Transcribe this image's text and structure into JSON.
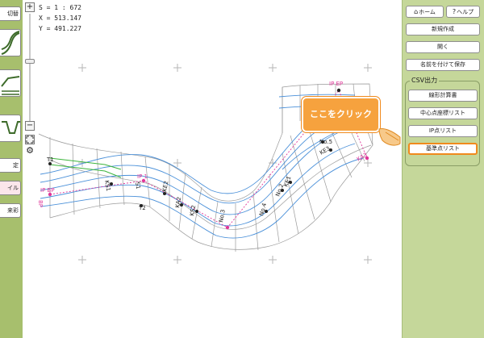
{
  "left_toolbar": {
    "top_label": "切替",
    "settings_label": "定",
    "style_label": "イル",
    "color_label": "来彩"
  },
  "zoom": {
    "plus_label": "+",
    "minus_label": "−"
  },
  "readout": {
    "scale": "S = 1 : 672",
    "x": "X = 513.147",
    "y": "Y = 491.227"
  },
  "map": {
    "labels": {
      "ip_ep": "IP EP",
      "ip_bp": "IP BP",
      "bp": "BP",
      "t1": "T1",
      "t2": "T2",
      "ip1": "IP 1",
      "ks1": "KS1",
      "sta": "S1",
      "kp2": "KE2",
      "kp3": "KA2",
      "ks2": "KS2",
      "no3": "No.3",
      "no4": "No.4",
      "no5": "No.5",
      "ke3": "KE3",
      "ka3": "KA3",
      "no2": "No.2",
      "ke1": "KE1"
    },
    "colors": {
      "blue_line": "#4a90d9",
      "pink_line": "#e0379a",
      "green_line": "#3cb43c",
      "grid_line": "#9a9a9a",
      "cross": "#b5b5b5"
    }
  },
  "right_panel": {
    "home_label": "ホーム",
    "help_label": "ヘルプ",
    "new_label": "新規作成",
    "open_label": "開く",
    "saveas_label": "名前を付けて保存",
    "csv_group_label": "CSV出力",
    "csv_buttons": [
      "線形計算書",
      "中心点座標リスト",
      "IP点リスト",
      "基準点リスト"
    ]
  },
  "callout": {
    "text": "ここをクリック",
    "color": "#f6a23e",
    "border": "#f08a1c"
  },
  "colors": {
    "left_strip": "#a7bf6d",
    "right_panel": "#c5d79a",
    "highlight": "#f08a1c"
  }
}
